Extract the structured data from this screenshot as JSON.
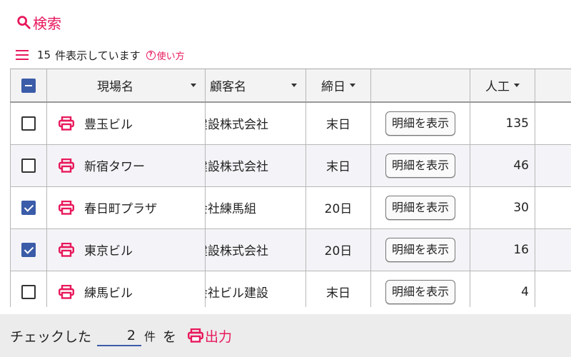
{
  "search": {
    "label": "検索",
    "icon": "search-icon"
  },
  "count_bar": {
    "count": "15",
    "text": "件表示しています",
    "help_label": "使い方",
    "help_icon": "question-circle-icon",
    "menu_icon": "hamburger-menu-icon"
  },
  "table": {
    "headers": {
      "site": "現場名",
      "customer": "顧客名",
      "closing": "締日",
      "labor": "人工"
    },
    "detail_button": "明細を表示",
    "rows": [
      {
        "site": "豊玉ビル",
        "customer": "建設株式会社",
        "closing": "末日",
        "labor": "135",
        "checked": false
      },
      {
        "site": "新宿タワー",
        "customer": "建設株式会社",
        "closing": "末日",
        "labor": "46",
        "checked": false
      },
      {
        "site": "春日町プラザ",
        "customer": "会社練馬組",
        "closing": "20日",
        "labor": "30",
        "checked": true
      },
      {
        "site": "東京ビル",
        "customer": "建設株式会社",
        "closing": "20日",
        "labor": "16",
        "checked": true
      },
      {
        "site": "練馬ビル",
        "customer": "会社ビル建設",
        "closing": "末日",
        "labor": "4",
        "checked": false
      }
    ]
  },
  "footer": {
    "prefix": "チェックした",
    "count": "2",
    "unit": "件",
    "particle": "を",
    "output_label": "出力",
    "output_icon": "printer-icon"
  },
  "colors": {
    "accent": "#e8185b",
    "checkbox": "#3b5ca8"
  }
}
